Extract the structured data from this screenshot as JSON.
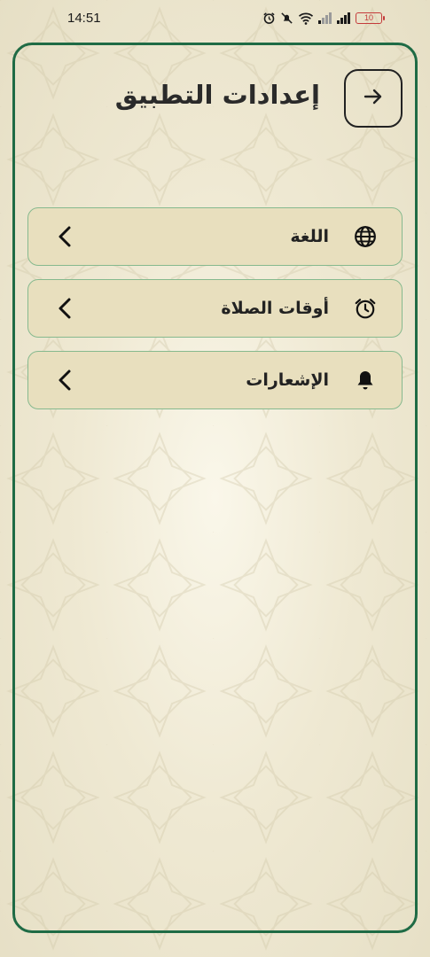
{
  "status_bar": {
    "time": "14:51",
    "battery_level": "10",
    "icons": [
      "alarm-icon",
      "mute-icon",
      "wifi-icon",
      "signal-icon",
      "signal-icon",
      "battery-icon"
    ],
    "battery_color": "#c43b3b"
  },
  "header": {
    "title": "إعدادات التطبيق",
    "back_icon": "arrow-right-icon"
  },
  "menu": {
    "items": [
      {
        "label": "اللغة",
        "icon": "globe-icon"
      },
      {
        "label": "أوقات الصلاة",
        "icon": "alarm-clock-icon"
      },
      {
        "label": "الإشعارات",
        "icon": "bell-icon"
      }
    ]
  },
  "colors": {
    "frame_border": "#1f6b45",
    "item_background": "#e8dfbe",
    "item_border": "#86b98e",
    "page_background": "#efe9d3"
  }
}
